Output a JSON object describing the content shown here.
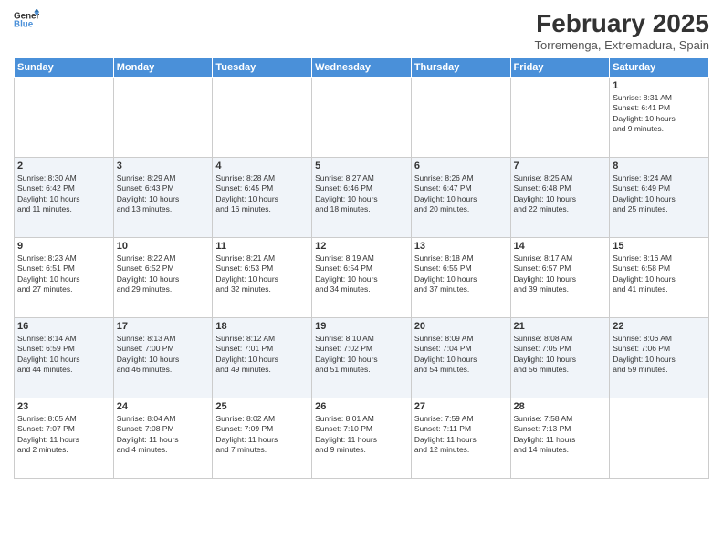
{
  "logo": {
    "general": "General",
    "blue": "Blue"
  },
  "header": {
    "month": "February 2025",
    "location": "Torremenga, Extremadura, Spain"
  },
  "weekdays": [
    "Sunday",
    "Monday",
    "Tuesday",
    "Wednesday",
    "Thursday",
    "Friday",
    "Saturday"
  ],
  "weeks": [
    [
      {
        "day": "",
        "info": ""
      },
      {
        "day": "",
        "info": ""
      },
      {
        "day": "",
        "info": ""
      },
      {
        "day": "",
        "info": ""
      },
      {
        "day": "",
        "info": ""
      },
      {
        "day": "",
        "info": ""
      },
      {
        "day": "1",
        "info": "Sunrise: 8:31 AM\nSunset: 6:41 PM\nDaylight: 10 hours\nand 9 minutes."
      }
    ],
    [
      {
        "day": "2",
        "info": "Sunrise: 8:30 AM\nSunset: 6:42 PM\nDaylight: 10 hours\nand 11 minutes."
      },
      {
        "day": "3",
        "info": "Sunrise: 8:29 AM\nSunset: 6:43 PM\nDaylight: 10 hours\nand 13 minutes."
      },
      {
        "day": "4",
        "info": "Sunrise: 8:28 AM\nSunset: 6:45 PM\nDaylight: 10 hours\nand 16 minutes."
      },
      {
        "day": "5",
        "info": "Sunrise: 8:27 AM\nSunset: 6:46 PM\nDaylight: 10 hours\nand 18 minutes."
      },
      {
        "day": "6",
        "info": "Sunrise: 8:26 AM\nSunset: 6:47 PM\nDaylight: 10 hours\nand 20 minutes."
      },
      {
        "day": "7",
        "info": "Sunrise: 8:25 AM\nSunset: 6:48 PM\nDaylight: 10 hours\nand 22 minutes."
      },
      {
        "day": "8",
        "info": "Sunrise: 8:24 AM\nSunset: 6:49 PM\nDaylight: 10 hours\nand 25 minutes."
      }
    ],
    [
      {
        "day": "9",
        "info": "Sunrise: 8:23 AM\nSunset: 6:51 PM\nDaylight: 10 hours\nand 27 minutes."
      },
      {
        "day": "10",
        "info": "Sunrise: 8:22 AM\nSunset: 6:52 PM\nDaylight: 10 hours\nand 29 minutes."
      },
      {
        "day": "11",
        "info": "Sunrise: 8:21 AM\nSunset: 6:53 PM\nDaylight: 10 hours\nand 32 minutes."
      },
      {
        "day": "12",
        "info": "Sunrise: 8:19 AM\nSunset: 6:54 PM\nDaylight: 10 hours\nand 34 minutes."
      },
      {
        "day": "13",
        "info": "Sunrise: 8:18 AM\nSunset: 6:55 PM\nDaylight: 10 hours\nand 37 minutes."
      },
      {
        "day": "14",
        "info": "Sunrise: 8:17 AM\nSunset: 6:57 PM\nDaylight: 10 hours\nand 39 minutes."
      },
      {
        "day": "15",
        "info": "Sunrise: 8:16 AM\nSunset: 6:58 PM\nDaylight: 10 hours\nand 41 minutes."
      }
    ],
    [
      {
        "day": "16",
        "info": "Sunrise: 8:14 AM\nSunset: 6:59 PM\nDaylight: 10 hours\nand 44 minutes."
      },
      {
        "day": "17",
        "info": "Sunrise: 8:13 AM\nSunset: 7:00 PM\nDaylight: 10 hours\nand 46 minutes."
      },
      {
        "day": "18",
        "info": "Sunrise: 8:12 AM\nSunset: 7:01 PM\nDaylight: 10 hours\nand 49 minutes."
      },
      {
        "day": "19",
        "info": "Sunrise: 8:10 AM\nSunset: 7:02 PM\nDaylight: 10 hours\nand 51 minutes."
      },
      {
        "day": "20",
        "info": "Sunrise: 8:09 AM\nSunset: 7:04 PM\nDaylight: 10 hours\nand 54 minutes."
      },
      {
        "day": "21",
        "info": "Sunrise: 8:08 AM\nSunset: 7:05 PM\nDaylight: 10 hours\nand 56 minutes."
      },
      {
        "day": "22",
        "info": "Sunrise: 8:06 AM\nSunset: 7:06 PM\nDaylight: 10 hours\nand 59 minutes."
      }
    ],
    [
      {
        "day": "23",
        "info": "Sunrise: 8:05 AM\nSunset: 7:07 PM\nDaylight: 11 hours\nand 2 minutes."
      },
      {
        "day": "24",
        "info": "Sunrise: 8:04 AM\nSunset: 7:08 PM\nDaylight: 11 hours\nand 4 minutes."
      },
      {
        "day": "25",
        "info": "Sunrise: 8:02 AM\nSunset: 7:09 PM\nDaylight: 11 hours\nand 7 minutes."
      },
      {
        "day": "26",
        "info": "Sunrise: 8:01 AM\nSunset: 7:10 PM\nDaylight: 11 hours\nand 9 minutes."
      },
      {
        "day": "27",
        "info": "Sunrise: 7:59 AM\nSunset: 7:11 PM\nDaylight: 11 hours\nand 12 minutes."
      },
      {
        "day": "28",
        "info": "Sunrise: 7:58 AM\nSunset: 7:13 PM\nDaylight: 11 hours\nand 14 minutes."
      },
      {
        "day": "",
        "info": ""
      }
    ]
  ]
}
